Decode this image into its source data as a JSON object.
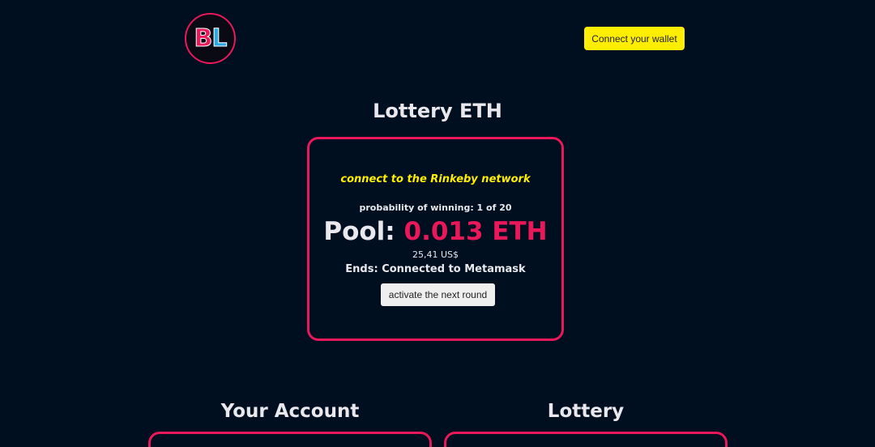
{
  "header": {
    "logo": {
      "letter1": "B",
      "letter2": "L"
    },
    "connect_wallet_label": "Connect your wallet"
  },
  "main": {
    "title": "Lottery ETH",
    "card": {
      "network_message": "connect to the Rinkeby network",
      "probability_text": "probability of winning: 1 of 20",
      "pool_label": "Pool:",
      "pool_amount": "0.013 ETH",
      "usd_value": "25,41 US$",
      "ends_text": "Ends: Connected to Metamask",
      "activate_label": "activate the next round"
    }
  },
  "sections": {
    "account_title": "Your Account",
    "lottery_title": "Lottery"
  },
  "colors": {
    "background": "#000f1f",
    "accent": "#e8185a",
    "highlight": "#ffee00"
  }
}
